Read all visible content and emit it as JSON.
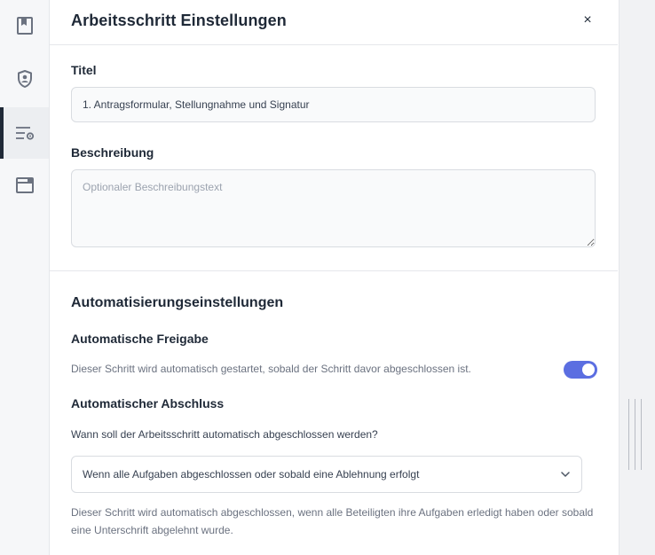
{
  "sidebar": {
    "items": [
      {
        "icon": "bookmark-icon"
      },
      {
        "icon": "shield-user-icon"
      },
      {
        "icon": "list-settings-icon",
        "active": true
      },
      {
        "icon": "window-icon"
      }
    ]
  },
  "header": {
    "title": "Arbeitsschritt Einstellungen",
    "close_label": "×"
  },
  "form": {
    "title_label": "Titel",
    "title_value": "1. Antragsformular, Stellungnahme und Signatur",
    "description_label": "Beschreibung",
    "description_placeholder": "Optionaler Beschreibungstext"
  },
  "automation": {
    "heading": "Automatisierungseinstellungen",
    "auto_release": {
      "label": "Automatische Freigabe",
      "description": "Dieser Schritt wird automatisch gestartet, sobald der Schritt davor abgeschlossen ist.",
      "enabled": true
    },
    "auto_complete": {
      "label": "Automatischer Abschluss",
      "question": "Wann soll der Arbeitsschritt automatisch abgeschlossen werden?",
      "selected": "Wenn alle Aufgaben abgeschlossen oder sobald eine Ablehnung erfolgt",
      "help": "Dieser Schritt wird automatisch abgeschlossen, wenn alle Beteiligten ihre Aufgaben erledigt haben oder sobald eine Unterschrift abgelehnt wurde."
    }
  },
  "colors": {
    "accent": "#5b6ee1",
    "active_indicator": "#1f2937"
  }
}
